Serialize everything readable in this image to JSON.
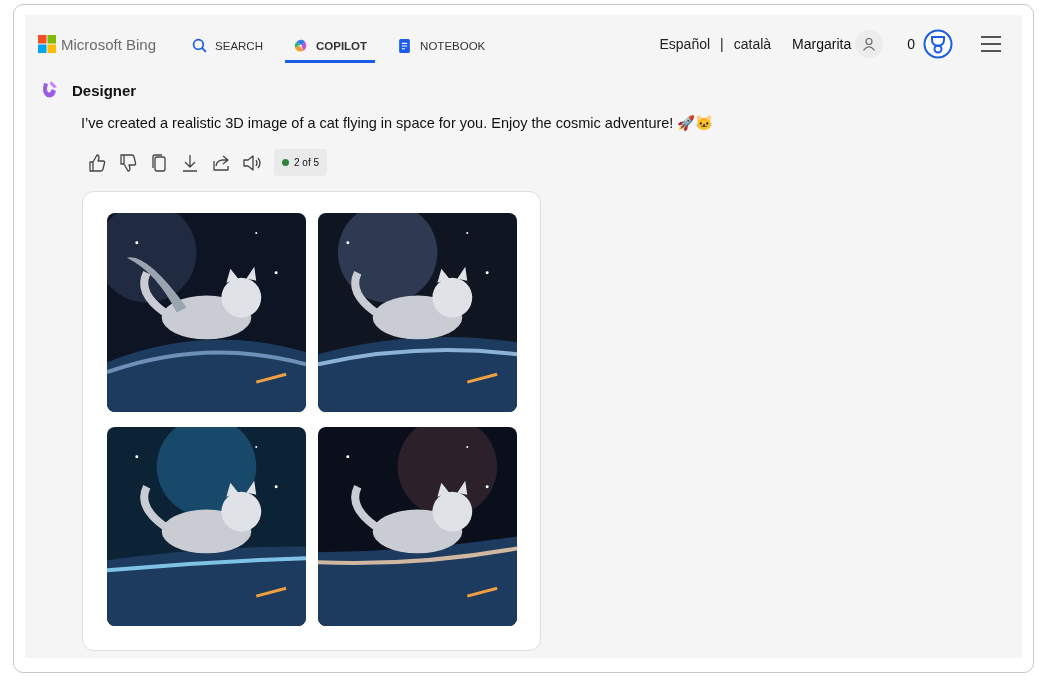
{
  "header": {
    "brand": "Microsoft Bing",
    "tabs": [
      {
        "label": "SEARCH",
        "selected": false
      },
      {
        "label": "COPILOT",
        "selected": true
      },
      {
        "label": "NOTEBOOK",
        "selected": false
      }
    ],
    "languages": [
      "Español",
      "|",
      "català"
    ],
    "user_name": "Margarita",
    "points": "0"
  },
  "message": {
    "sender": "Designer",
    "text": "I’ve created a realistic 3D image of a cat flying in space for you. Enjoy the cosmic adventure! 🚀🐱",
    "counter": "2 of 5"
  }
}
